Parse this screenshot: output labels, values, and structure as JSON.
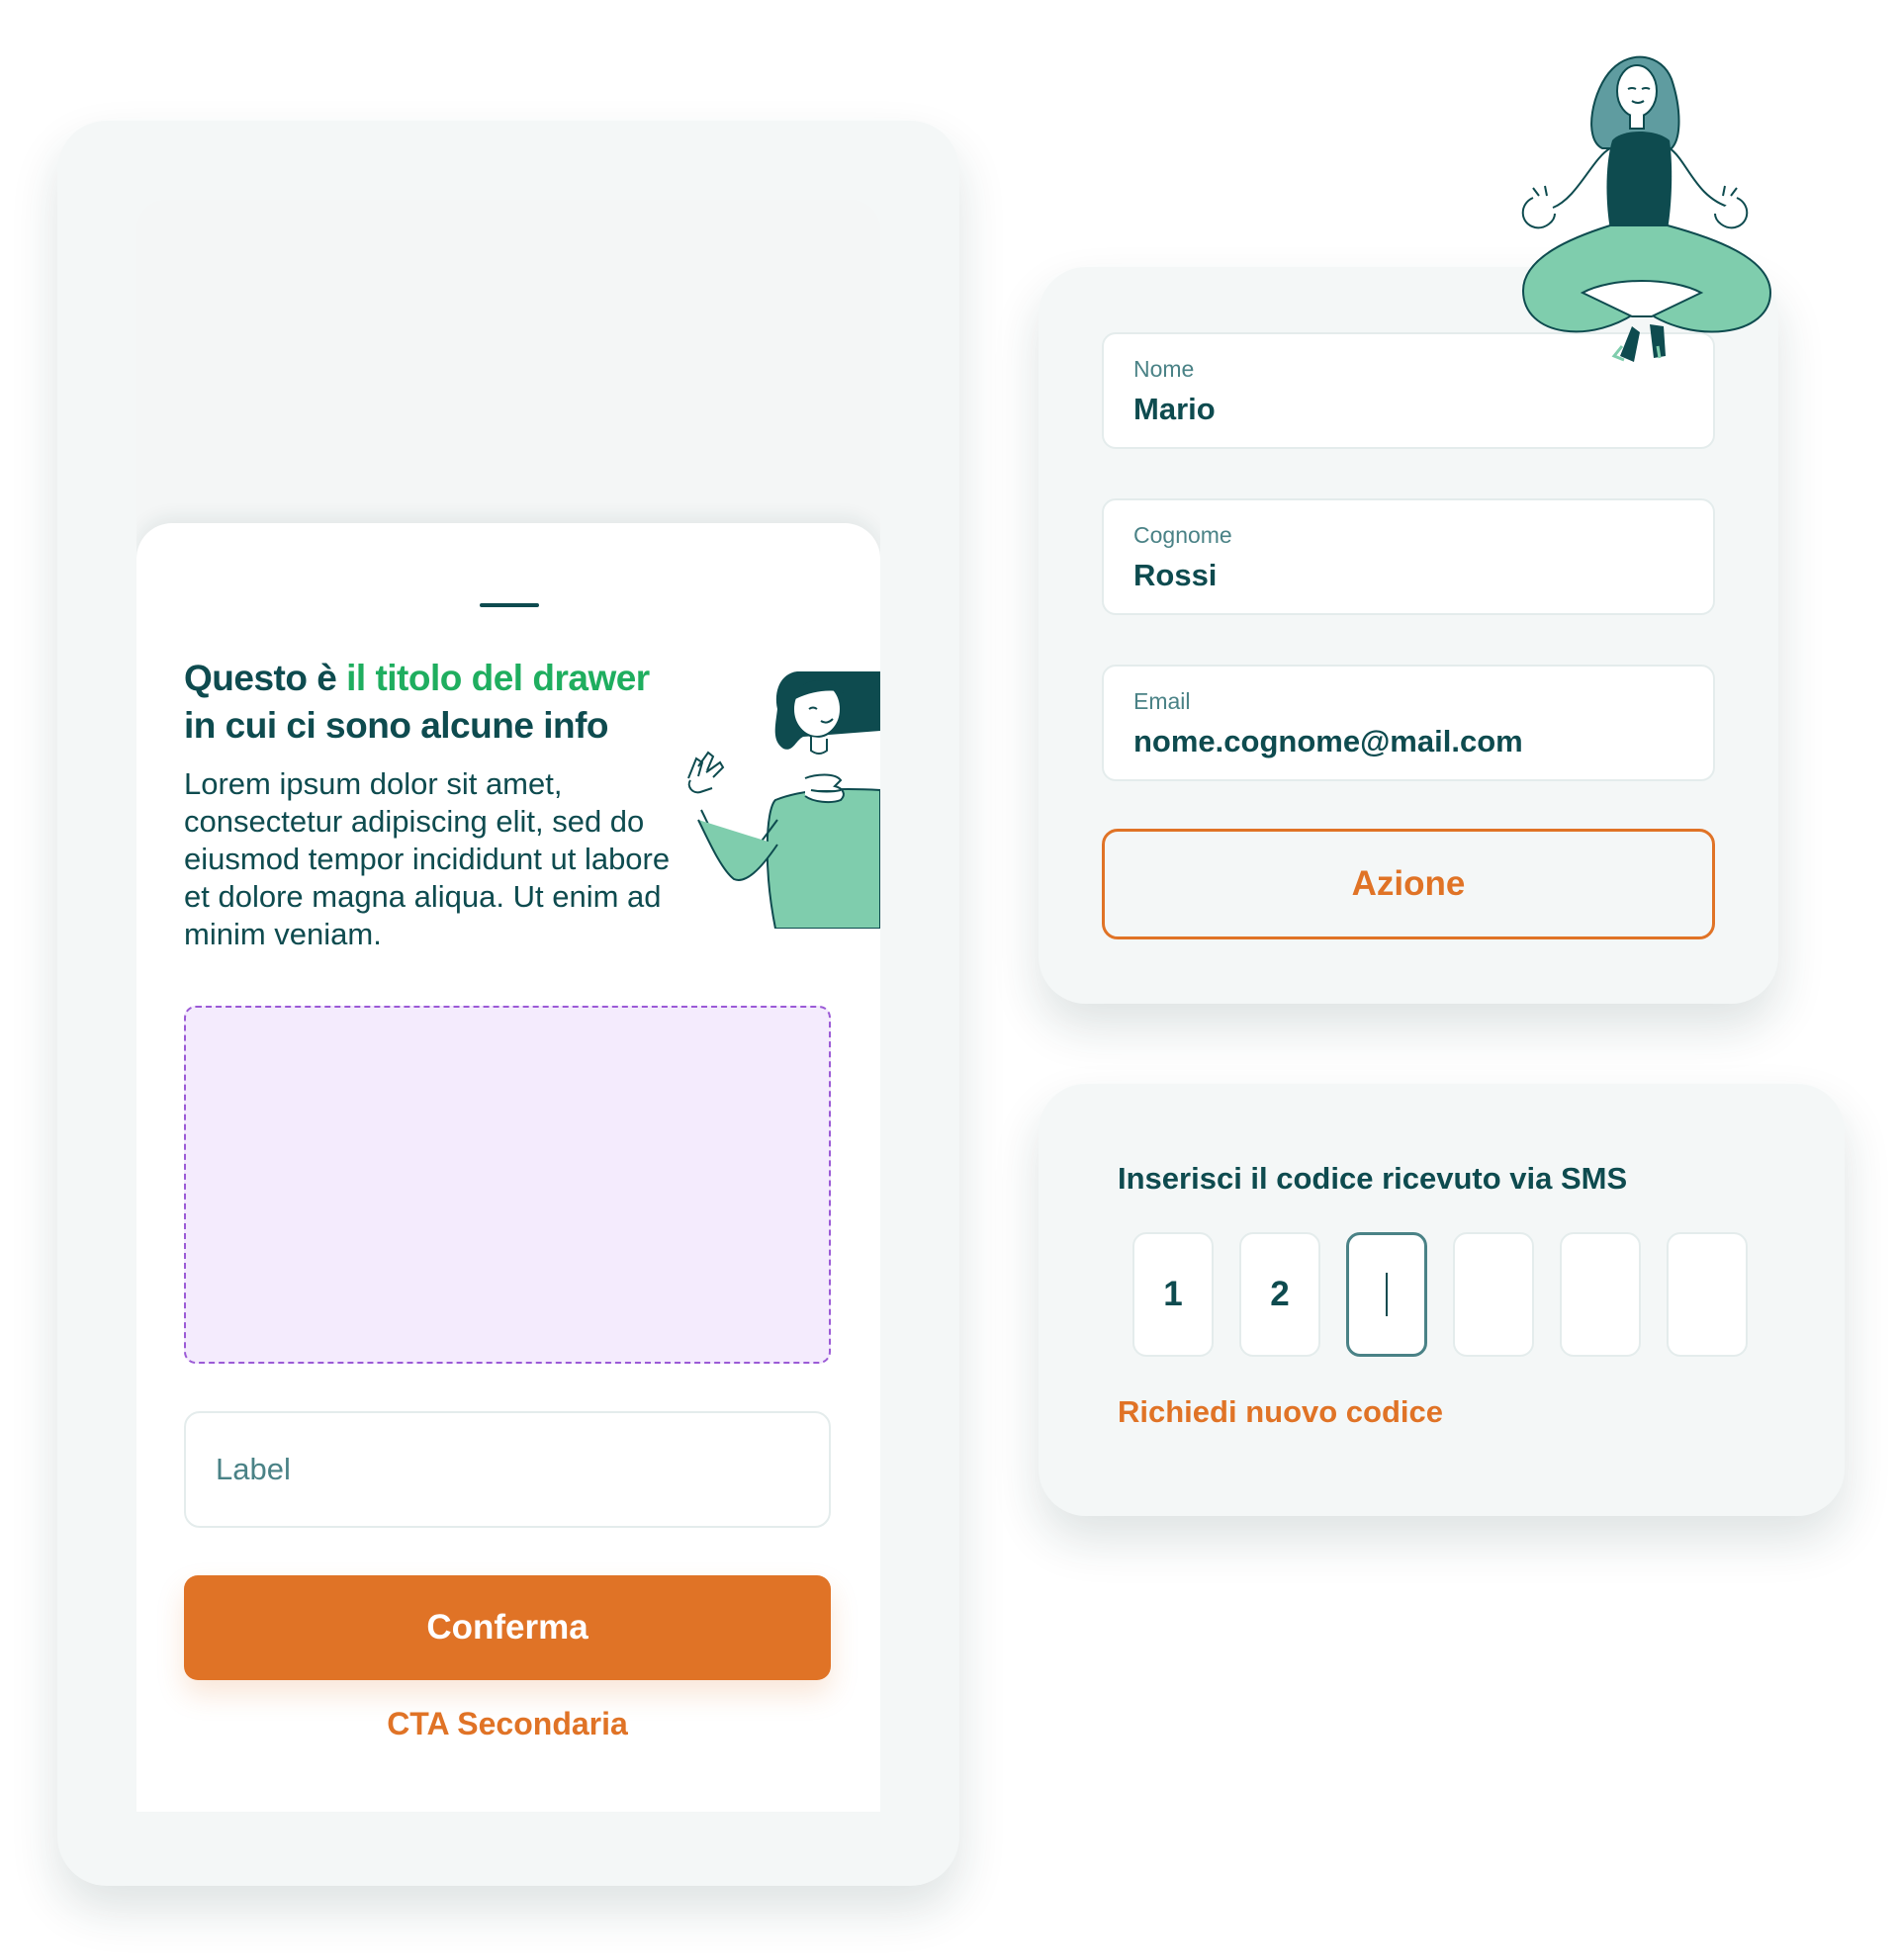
{
  "drawer": {
    "title_part1": "Questo è ",
    "title_highlight": "il titolo del drawer",
    "title_part2": "in cui ci sono alcune info",
    "body": "Lorem ipsum dolor sit amet, consectetur adipiscing elit, sed do eiusmod tempor incididunt ut labore et dolore magna aliqua. Ut enim ad minim veniam.",
    "input_label": "Label",
    "primary_button": "Conferma",
    "secondary_link": "CTA Secondaria"
  },
  "form": {
    "fields": [
      {
        "label": "Nome",
        "value": "Mario"
      },
      {
        "label": "Cognome",
        "value": "Rossi"
      },
      {
        "label": "Email",
        "value": "nome.cognome@mail.com"
      }
    ],
    "action_button": "Azione"
  },
  "otp": {
    "title": "Inserisci il codice ricevuto via SMS",
    "digits": [
      "1",
      "2",
      "",
      "",
      "",
      ""
    ],
    "active_index": 2,
    "resend_link": "Richiedi nuovo codice"
  },
  "colors": {
    "primary_dark": "#0e4b4f",
    "highlight_green": "#1fae5f",
    "accent_orange": "#e07326",
    "illustration_mint": "#7fcdad",
    "slot_fill": "#f4ebfd",
    "slot_border": "#9b5ad6"
  },
  "illustrations": [
    "woman-waving-illustration",
    "meditating-woman-illustration"
  ]
}
